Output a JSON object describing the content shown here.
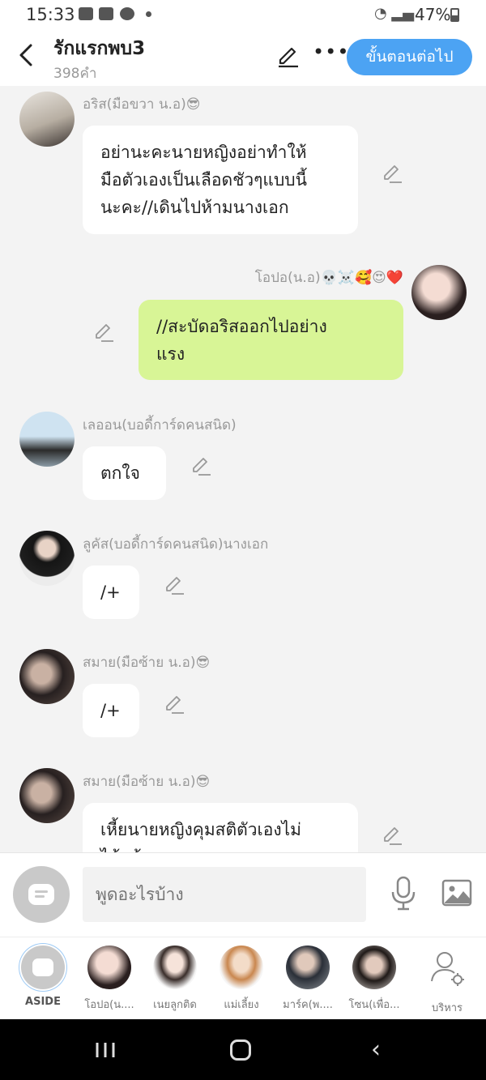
{
  "status_bar": {
    "time": "15:33",
    "battery": "47%"
  },
  "header": {
    "title": "รักแรกพบ3",
    "word_count": "398คำ",
    "next_label": "ขั้นตอนต่อไป"
  },
  "messages": [
    {
      "name": "อริส(มือขวา น.อ)😎",
      "text": "อย่านะคะนายหญิงอย่าทำให้\nมือตัวเองเป็นเลือดชัวๆแบบนี้\nนะคะ//เดินไปห้ามนางเอก",
      "side": "left"
    },
    {
      "name": "โอปอ(น.อ)💀☠️🥰😍❤️",
      "text": "//สะบัดอริสออกไปอย่าง\nแรง",
      "side": "right"
    },
    {
      "name": "เลออน(บอดี้การ์ดคนสนิด)",
      "text": "ตกใจ",
      "side": "left"
    },
    {
      "name": "ลูคัส(บอดี้การ์ดคนสนิด)นางเอก",
      "text": "/+",
      "side": "left"
    },
    {
      "name": "สมาย(มือซ้าย น.อ)😎",
      "text": "/+",
      "side": "left"
    },
    {
      "name": "สมาย(มือซ้าย น.อ)😎",
      "text": "เหี้ยนายหญิงคุมสติตัวเองไม่\nได้แล้ว",
      "side": "left"
    }
  ],
  "input": {
    "placeholder": "พูดอะไรบ้าง"
  },
  "cast": [
    {
      "label": "ASIDE"
    },
    {
      "label": "โอปอ(น...."
    },
    {
      "label": "เนยลูกติด"
    },
    {
      "label": "แม่เลี้ยง"
    },
    {
      "label": "มาร์ค(พ...."
    },
    {
      "label": "โซน(เพื่อ..."
    },
    {
      "label": "บริหาร"
    }
  ],
  "colors": {
    "accent": "#4ca3f3",
    "my_bubble": "#d8f596",
    "background": "#f3f3f3"
  }
}
